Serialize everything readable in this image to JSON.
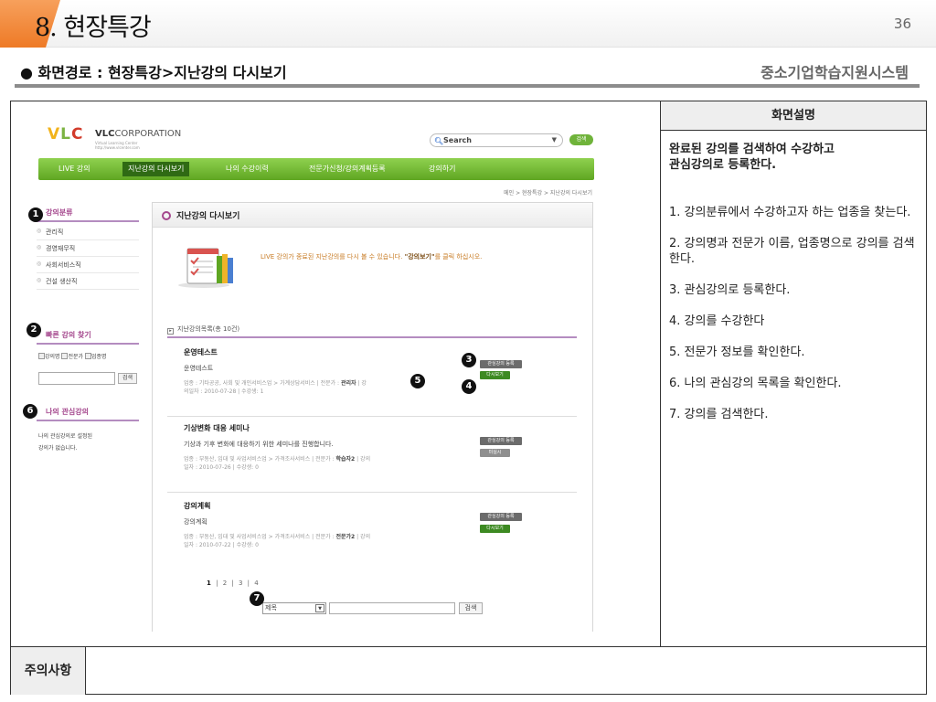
{
  "slide": {
    "section_number": "8.",
    "title": "현장특강",
    "page_number": "36",
    "path": "● 화면경로 : 현장특강>지난강의 다시보기",
    "system_name": "중소기업학습지원시스템"
  },
  "description_panel": {
    "header": "화면설명",
    "summary_line1": "완료된 강의를 검색하여 수강하고",
    "summary_line2": "관심강의로 등록한다.",
    "steps": [
      "1. 강의분류에서 수강하고자 하는 업종을 찾는다.",
      "2. 강의명과 전문가 이름, 업종명으로 강의를 검색한다.",
      "3. 관심강의로 등록한다.",
      "4. 강의를 수강한다",
      "5. 전문가 정보를 확인한다.",
      "6. 나의 관심강의 목록을 확인한다.",
      "7. 강의를 검색한다."
    ]
  },
  "caution": {
    "label": "주의사항"
  },
  "site": {
    "logo_text": "VLC",
    "logo_corp_bold": "VLC",
    "logo_corp_rest": "CORPORATION",
    "logo_sub1": "Virtual Learning Center",
    "logo_sub2": "http://www.vlcenter.com",
    "search_text": "Search",
    "search_button": "검색",
    "nav": [
      "LIVE 강의",
      "지난강의 다시보기",
      "나의 수강이력",
      "전문가신청/강의계획등록",
      "강의하기"
    ],
    "breadcrumb": "메인 > 현장특강 > 지난강의 다시보기",
    "sidebar": {
      "category_heading": "강의분류",
      "categories": [
        "관리직",
        "경영재무직",
        "사회서비스직",
        "건설 생산직"
      ],
      "fast_heading": "빠른 강의 찾기",
      "fast_options": [
        "강의명",
        "전문가",
        "업종명"
      ],
      "fast_button": "검색",
      "fav_heading": "나의 관심강의",
      "fav_empty_line1": "나의 관심강의로 설정된",
      "fav_empty_line2": "강의가 없습니다."
    },
    "content": {
      "heading": "지난강의 다시보기",
      "hero_message_pre": "LIVE 강의가 종료된 지난강의를 다시 볼 수 있습니다. ",
      "hero_message_bold": "\"강의보기\"",
      "hero_message_post": "를 클릭 하십시오.",
      "list_title": "지난강의목록(총 10건)",
      "courses": [
        {
          "title": "운영테스트",
          "desc": "운영테스트",
          "meta1": "업종 : 기타공공, 사회 및 개인서비스업 > 가계상담서비스 | 전문가 : ",
          "expert": "관리자",
          "meta2": " | 강",
          "meta3": "의일자 : 2010-07-28 | 수강생: 1",
          "btn1": "관심강의 등록",
          "btn2": "다시보기"
        },
        {
          "title": "기상변화 대응 세미나",
          "desc": "기상과 기후 변화에 대응하기 위한 세미나를 진행합니다.",
          "meta1": "업종 : 부동산, 임대 및 사업서비스업 > 가격조사서비스 | 전문가 : ",
          "expert": "학습자2",
          "meta2": " | 강의",
          "meta3": "일자 : 2010-07-26 | 수강생: 0",
          "btn1": "관심강의 등록",
          "btn2": "미실시"
        },
        {
          "title": "강의계획",
          "desc": "강의계획",
          "meta1": "업종 : 부동산, 임대 및 사업서비스업 > 가격조사서비스 | 전문가 : ",
          "expert": "전문가2",
          "meta2": " | 강의",
          "meta3": "일자 : 2010-07-22 | 수강생: 0",
          "btn1": "관심강의 등록",
          "btn2": "다시보기"
        }
      ],
      "pages": [
        "1",
        "2",
        "3",
        "4"
      ],
      "search_select": "제목",
      "search_button": "검색"
    }
  },
  "markers": [
    "1",
    "2",
    "3",
    "4",
    "5",
    "6",
    "7"
  ],
  "colors": {
    "accent_orange": "#ee7a26",
    "nav_green": "#6fb33a",
    "sidebar_purple": "#a4478d"
  }
}
